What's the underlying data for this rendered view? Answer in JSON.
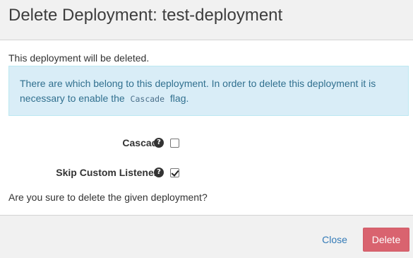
{
  "dialog": {
    "title": "Delete Deployment: test-deployment",
    "intro": "This deployment will be deleted.",
    "alert": {
      "line1": "There are which belong to this deployment. In order to delete this deployment it is",
      "line2_before": "necessary to enable the",
      "code": "Cascade",
      "line2_after": "flag."
    },
    "options": [
      {
        "label": "Cascade",
        "help_icon": "question-circle-icon",
        "checked": false
      },
      {
        "label": "Skip Custom Listeners",
        "help_icon": "question-circle-icon",
        "checked": true
      }
    ],
    "confirm_text": "Are you sure to delete the given deployment?",
    "footer": {
      "close_label": "Close",
      "delete_label": "Delete"
    }
  },
  "colors": {
    "header_bg": "#f1f1f1",
    "alert_bg": "#d9edf7",
    "alert_text": "#31708f",
    "link": "#337ab7",
    "danger": "#d9636f"
  },
  "icons": {
    "help": "question-circle-icon",
    "check": "checkmark-icon"
  }
}
